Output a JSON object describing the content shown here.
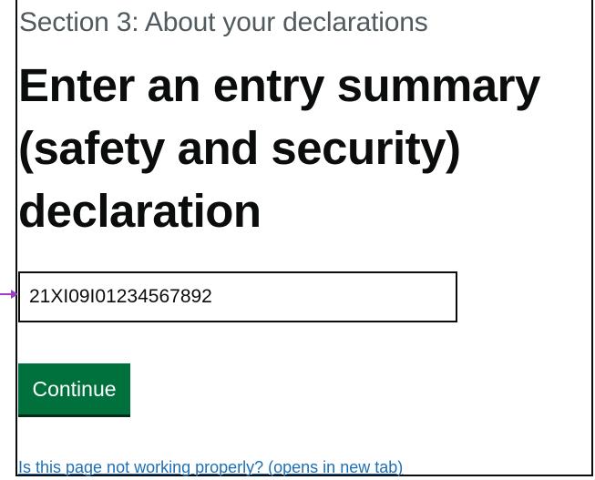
{
  "caption": "Section 3: About your declarations",
  "heading": {
    "line1": "Enter an entry summary",
    "line2": "(safety and security)",
    "line3": "declaration"
  },
  "declaration_input": {
    "value": "21XI09I01234567892"
  },
  "continue_button": {
    "label": "Continue"
  },
  "help_link": {
    "label": "Is this page not working properly? (opens in new tab)"
  },
  "colors": {
    "button_green": "#00703c",
    "link_blue": "#1d70b8",
    "arrow_purple": "#9b3fc7",
    "text_dark": "#0b0c0c",
    "caption_grey": "#505a5f"
  },
  "icons": {
    "pointer": "arrow-right-icon"
  }
}
